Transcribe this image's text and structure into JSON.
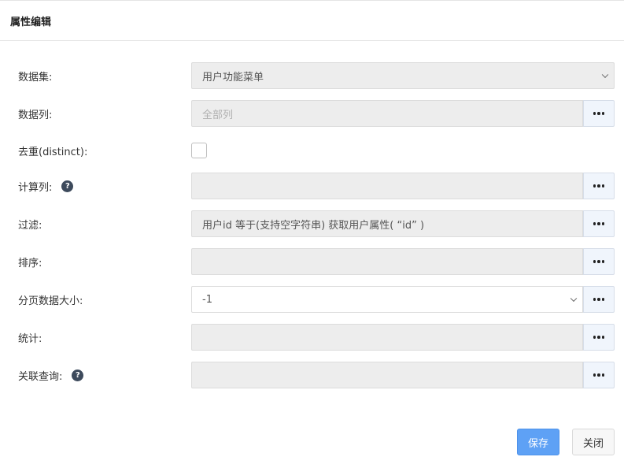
{
  "dialog": {
    "title": "属性编辑"
  },
  "form": {
    "dataset": {
      "label": "数据集:",
      "value": "用户功能菜单"
    },
    "columns": {
      "label": "数据列:",
      "placeholder": "全部列"
    },
    "distinct": {
      "label": "去重(distinct):",
      "checked": false
    },
    "computed": {
      "label": "计算列:",
      "value": ""
    },
    "filter": {
      "label": "过滤:",
      "value": "用户id 等于(支持空字符串) 获取用户属性( “id” )"
    },
    "sort": {
      "label": "排序:",
      "value": ""
    },
    "page_size": {
      "label": "分页数据大小:",
      "value": "-1"
    },
    "stats": {
      "label": "统计:",
      "value": ""
    },
    "join": {
      "label": "关联查询:",
      "value": ""
    }
  },
  "icons": {
    "help": "question-circle-icon",
    "more": "ellipsis-icon",
    "dropdown": "chevron-down-icon"
  },
  "buttons": {
    "save": "保存",
    "close": "关闭"
  },
  "colors": {
    "primary": "#5ea1f5",
    "help_icon": "#3d4a5c",
    "field_bg": "#ededed"
  }
}
